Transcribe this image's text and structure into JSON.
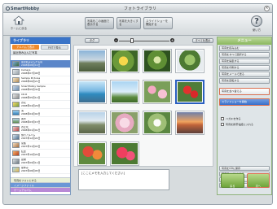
{
  "app": {
    "logo": "SmartHobby",
    "title": "フォトライブラリ"
  },
  "toolbar": {
    "home_label": "ホームに戻る",
    "buttons": [
      "写真をこの画面で表示する",
      "写真を大きくする",
      "スライドショーを開始する"
    ],
    "help_label": "使い方"
  },
  "left": {
    "tab": "ライブラリ",
    "filters": [
      "アルバムで表示",
      "日付で表示"
    ],
    "header": "最近読み込んだ写真",
    "albums": [
      {
        "name": "最近読み込んだ写真",
        "date": "2008年08月16日"
      },
      {
        "name": "Camera",
        "date": "2008年07月08日"
      },
      {
        "name": "Sample Pictures",
        "date": "2008年06月21日"
      },
      {
        "name": "SmartHobby Sample",
        "date": "2008年05月30日"
      },
      {
        "name": "CD-R",
        "date": "2008年05月12日"
      },
      {
        "name": "お花",
        "date": "2008年04月29日"
      },
      {
        "name": "海",
        "date": "2008年04月02日"
      },
      {
        "name": "風景",
        "date": "2008年03月15日"
      },
      {
        "name": "お正月",
        "date": "2008年01月01日"
      },
      {
        "name": "旅行アルバム",
        "date": "2007年12月24日"
      },
      {
        "name": "家族",
        "date": "2007年11月03日"
      },
      {
        "name": "紅葉",
        "date": "2007年10月20日"
      },
      {
        "name": "建物",
        "date": "2007年09月11日"
      },
      {
        "name": "夏休み",
        "date": "2007年08月05日"
      }
    ],
    "footer": [
      "写真をフォトにする",
      "イメージファイル",
      "ゲームアルバム"
    ]
  },
  "center": {
    "tag_button": "タグ",
    "all_button": "すべてを表示",
    "caption_placeholder": "[ここにメモを入力してください]",
    "photos": [
      "landscape",
      "yellow-flower",
      "green-plant",
      "tree",
      "sea",
      "sky",
      "flowers",
      "red-flowers",
      "mountain",
      "cherry-blossom",
      "white-flower",
      "sunset",
      "autumn",
      "red-azalea"
    ]
  },
  "right": {
    "header": "メニュー",
    "items_top": [
      "写真を読み込む",
      "写真をすべて選択する",
      "写真を編集する",
      "写真を印刷する",
      "写真をメールで送る",
      "写真を回転する"
    ],
    "highlight_item": "写真を並べ替える",
    "blue_item": "スライドショーを開始",
    "checks": [
      "ハガキを作る",
      "写真を携帯電話に入れる"
    ],
    "items_bottom": [
      "写真をCDに保存",
      "写真アルバムを作る",
      "ZIP",
      "携帯のビーファイル"
    ],
    "btn_left": "戻る",
    "btn_right": "次へ"
  },
  "colors": {
    "accent": "#3a74c8",
    "highlight": "#d96e4f",
    "menu_green": "#8ab65c"
  }
}
